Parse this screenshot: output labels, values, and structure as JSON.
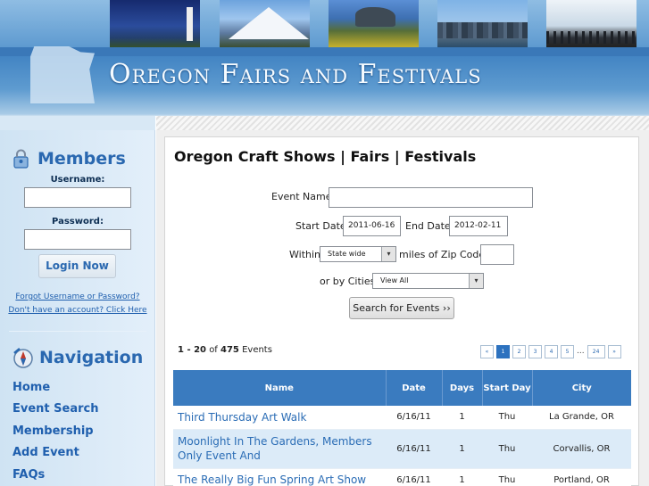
{
  "header": {
    "title": "Oregon Fairs and Festivals"
  },
  "sidebar": {
    "members": {
      "heading": "Members",
      "username_label": "Username:",
      "password_label": "Password:",
      "login_button": "Login Now",
      "forgot_link": "Forgot Username or Password?",
      "signup_link": "Don't have an account? Click Here"
    },
    "navigation": {
      "heading": "Navigation",
      "items": [
        "Home",
        "Event Search",
        "Membership",
        "Add Event",
        "FAQs"
      ]
    }
  },
  "main": {
    "title": "Oregon Craft Shows | Fairs | Festivals",
    "form": {
      "event_name_label": "Event Name",
      "event_name_value": "",
      "start_date_label": "Start Date",
      "start_date_value": "2011-06-16",
      "end_date_label": "End Date",
      "end_date_value": "2012-02-11",
      "within_label": "Within",
      "within_value": "State wide",
      "zip_label": "miles of Zip Code:",
      "zip_value": "",
      "cities_label": "or by Cities",
      "cities_value": "View All",
      "search_button": "Search for Events ››"
    },
    "results": {
      "range": "1 - 20",
      "of_text": "of",
      "total": "475",
      "suffix": "Events"
    },
    "pagination": {
      "prev": "«",
      "pages": [
        "1",
        "2",
        "3",
        "4",
        "5"
      ],
      "ellipsis": "...",
      "last": "24",
      "next": "»",
      "current": "1"
    },
    "table": {
      "headers": {
        "name": "Name",
        "date": "Date",
        "days": "Days",
        "start_day": "Start Day",
        "city": "City"
      },
      "rows": [
        {
          "name": "Third Thursday Art Walk",
          "date": "6/16/11",
          "days": "1",
          "start_day": "Thu",
          "city": "La Grande, OR"
        },
        {
          "name": "Moonlight In The Gardens, Members Only Event And",
          "date": "6/16/11",
          "days": "1",
          "start_day": "Thu",
          "city": "Corvallis, OR"
        },
        {
          "name": "The Really Big Fun Spring Art Show",
          "date": "6/16/11",
          "days": "1",
          "start_day": "Thu",
          "city": "Portland, OR"
        }
      ]
    }
  },
  "colors": {
    "header_blue": "#3c7fc0",
    "link_blue": "#2a68b0",
    "table_header": "#3a7bbf",
    "row_alt": "#dcebf8"
  },
  "icons": {
    "members": "lock-user-icon",
    "navigation": "compass-icon"
  }
}
